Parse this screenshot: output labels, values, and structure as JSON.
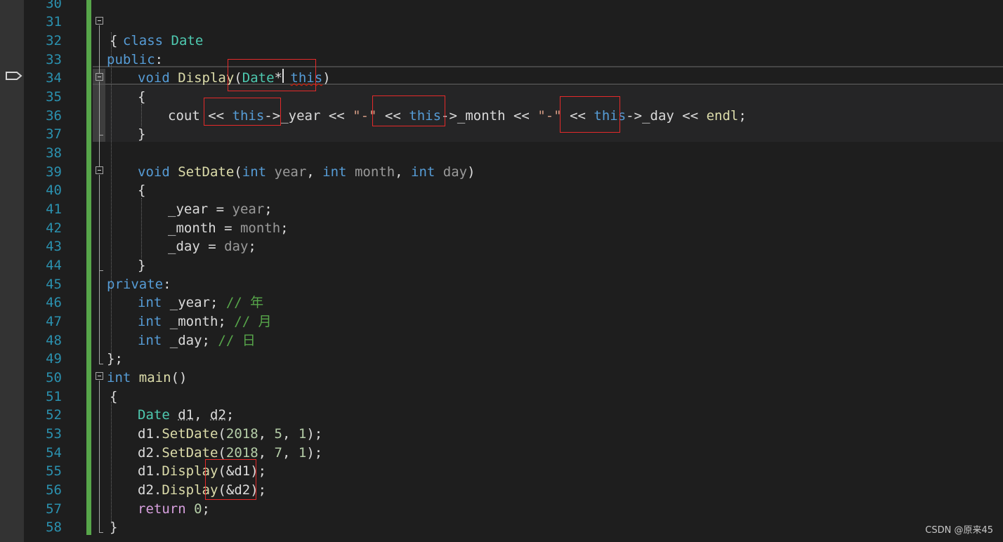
{
  "editor": {
    "line_numbers": [
      "30",
      "31",
      "32",
      "33",
      "34",
      "35",
      "36",
      "37",
      "38",
      "39",
      "40",
      "41",
      "42",
      "43",
      "44",
      "45",
      "46",
      "47",
      "48",
      "49",
      "50",
      "51",
      "52",
      "53",
      "54",
      "55",
      "56",
      "57",
      "58"
    ],
    "code": {
      "l31": {
        "kw": "class",
        "name": "Date"
      },
      "l32": {
        "brace": "{"
      },
      "l33": {
        "kw": "public",
        "colon": ":"
      },
      "l34": {
        "ret": "void",
        "fn": "Display",
        "open": "(",
        "type": "Date",
        "star": "*",
        "param": "this",
        "close": ")"
      },
      "l35": {
        "brace": "{"
      },
      "l36": {
        "cout": "cout ",
        "op1": "<< ",
        "this1": "this",
        "arrow1": "->",
        "f1": "_year",
        "op2": " << ",
        "s1": "\"-\"",
        "op3": " << ",
        "this2": "this",
        "arrow2": "->",
        "f2": "_month",
        "op4": " << ",
        "s2": "\"-\"",
        "op5": " << ",
        "this3": "this",
        "arrow3": "->",
        "f3": "_day",
        "op6": " << ",
        "endl": "endl",
        "semi": ";"
      },
      "l37": {
        "brace": "}"
      },
      "l39": {
        "ret": "void",
        "fn": "SetDate",
        "open": "(",
        "t1": "int",
        "p1": " year",
        "c1": ", ",
        "t2": "int",
        "p2": " month",
        "c2": ", ",
        "t3": "int",
        "p3": " day",
        "close": ")"
      },
      "l40": {
        "brace": "{"
      },
      "l41": {
        "field": "_year",
        "eq": " = ",
        "val": "year",
        "semi": ";"
      },
      "l42": {
        "field": "_month",
        "eq": " = ",
        "val": "month",
        "semi": ";"
      },
      "l43": {
        "field": "_day",
        "eq": " = ",
        "val": "day",
        "semi": ";"
      },
      "l44": {
        "brace": "}"
      },
      "l45": {
        "kw": "private",
        "colon": ":"
      },
      "l46": {
        "type": "int",
        "field": " _year",
        "semi": ";",
        "comment": " // 年"
      },
      "l47": {
        "type": "int",
        "field": " _month",
        "semi": ";",
        "comment": " // 月"
      },
      "l48": {
        "type": "int",
        "field": " _day",
        "semi": ";",
        "comment": " // 日"
      },
      "l49": {
        "brace": "};"
      },
      "l50": {
        "type": "int",
        "fn": " main",
        "parens": "()"
      },
      "l51": {
        "brace": "{"
      },
      "l52": {
        "type": "Date",
        "v1": "d1",
        "comma": ", ",
        "v2": "d2",
        "semi": ";"
      },
      "l53": {
        "obj": "d1",
        "dot": ".",
        "fn": "SetDate",
        "open": "(",
        "a1": "2018",
        "c1": ", ",
        "a2": "5",
        "c2": ", ",
        "a3": "1",
        "close": ");"
      },
      "l54": {
        "obj": "d2",
        "dot": ".",
        "fn": "SetDate",
        "open": "(",
        "a1": "2018",
        "c1": ", ",
        "a2": "7",
        "c2": ", ",
        "a3": "1",
        "close": ");"
      },
      "l55": {
        "obj": "d1",
        "dot": ".",
        "fn": "Display",
        "open": "(",
        "arg": "&d1",
        "close": ");"
      },
      "l56": {
        "obj": "d2",
        "dot": ".",
        "fn": "Display",
        "open": "(",
        "arg": "&d2",
        "close": ");"
      },
      "l57": {
        "kw": "return",
        "num": " 0",
        "semi": ";"
      },
      "l58": {
        "brace": "}"
      }
    }
  },
  "watermark": "CSDN @原来45",
  "colors": {
    "background": "#1e1e1e",
    "line_number": "#2b91af",
    "keyword": "#569cd6",
    "type": "#4ec9b0",
    "function": "#dcdcaa",
    "parameter": "#9a9a9a",
    "string": "#d69d85",
    "number": "#b5cea8",
    "comment": "#57a64a",
    "annotation_box": "#e52a2a",
    "change_bar": "#57a64a"
  }
}
